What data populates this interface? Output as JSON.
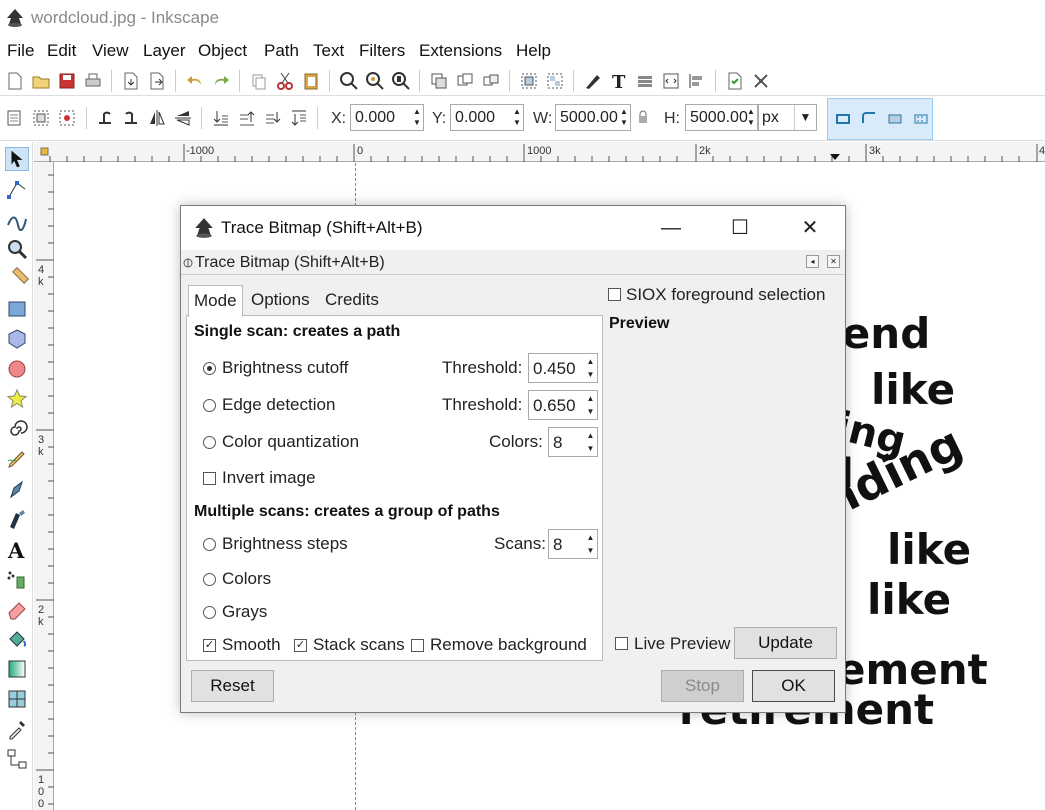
{
  "window": {
    "title": "wordcloud.jpg - Inkscape"
  },
  "menu": [
    "File",
    "Edit",
    "View",
    "Layer",
    "Object",
    "Path",
    "Text",
    "Filters",
    "Extensions",
    "Help"
  ],
  "toolbar": {
    "x_label": "X:",
    "x_value": "0.000",
    "y_label": "Y:",
    "y_value": "0.000",
    "w_label": "W:",
    "w_value": "5000.00",
    "h_label": "H:",
    "h_value": "5000.00",
    "unit": "px"
  },
  "ruler": {
    "h_labels": [
      "-1000",
      "0",
      "1000",
      "2k",
      "3k",
      "4"
    ],
    "v_labels": [
      "4",
      "k",
      "3",
      "k",
      "2",
      "k",
      "1",
      "0",
      "0"
    ]
  },
  "canvas": {
    "words": [
      "kend",
      "like",
      "ing",
      "nding",
      "like",
      "like",
      "ement",
      "retirement",
      "l"
    ]
  },
  "dialog": {
    "window_title": "Trace Bitmap (Shift+Alt+B)",
    "header_title": "Trace Bitmap (Shift+Alt+B)",
    "tabs": [
      "Mode",
      "Options",
      "Credits"
    ],
    "single_scan_title": "Single scan: creates a path",
    "brightness_cutoff": "Brightness cutoff",
    "edge_detection": "Edge detection",
    "color_quantization": "Color quantization",
    "invert_image": "Invert image",
    "threshold_label": "Threshold:",
    "threshold1": "0.450",
    "threshold2": "0.650",
    "colors_label": "Colors:",
    "colors_value": "8",
    "multi_scan_title": "Multiple scans: creates a group of paths",
    "brightness_steps": "Brightness steps",
    "colors_option": "Colors",
    "grays_option": "Grays",
    "scans_label": "Scans:",
    "scans_value": "8",
    "smooth": "Smooth",
    "stack_scans": "Stack scans",
    "remove_background": "Remove background",
    "siox": "SIOX foreground selection",
    "preview_title": "Preview",
    "live_preview": "Live Preview",
    "update_button": "Update",
    "reset_button": "Reset",
    "stop_button": "Stop",
    "ok_button": "OK"
  },
  "colors": {
    "accent": "#d9ebfa",
    "dialog_bg": "#f0f0f0"
  }
}
